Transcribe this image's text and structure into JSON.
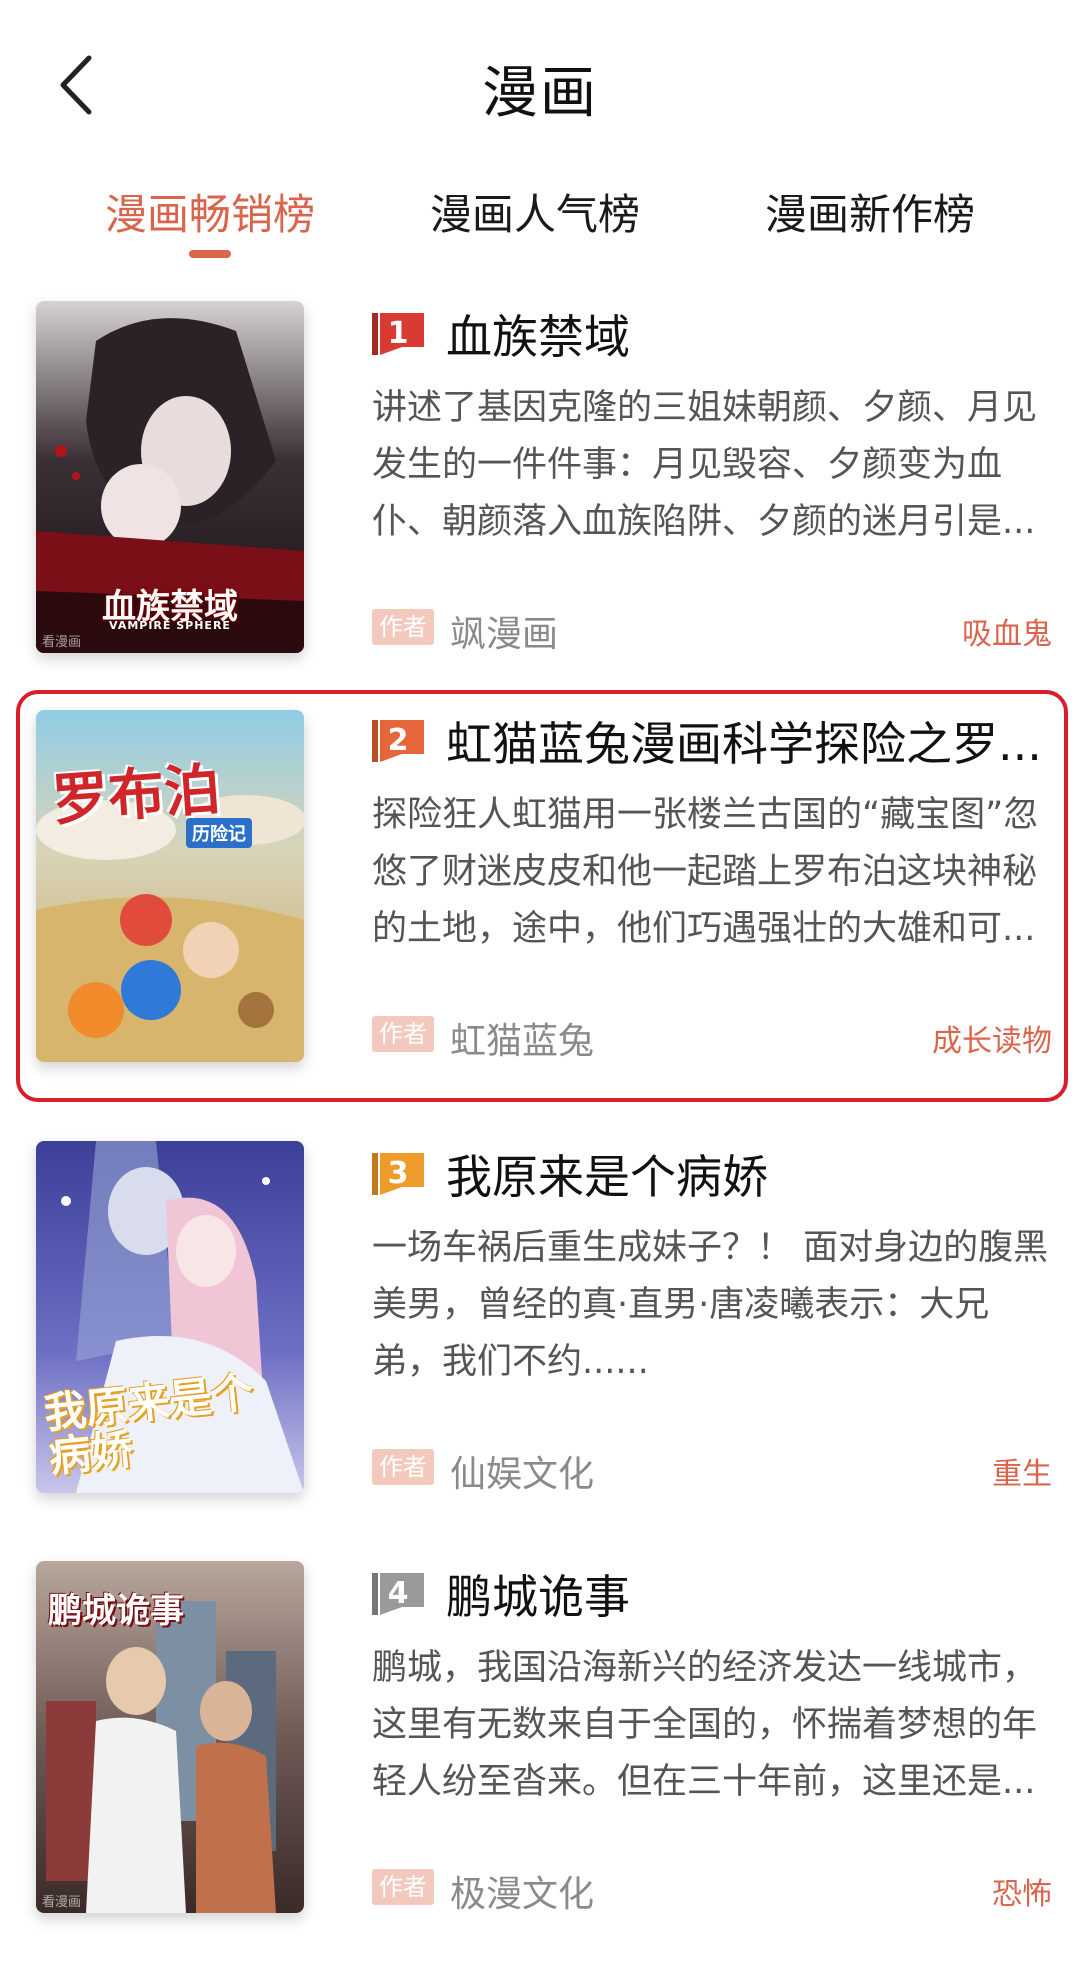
{
  "header": {
    "title": "漫画"
  },
  "tabs": [
    {
      "label": "漫画畅销榜",
      "active": true
    },
    {
      "label": "漫画人气榜",
      "active": false
    },
    {
      "label": "漫画新作榜",
      "active": false
    }
  ],
  "author_tag": "作者",
  "items": [
    {
      "rank": "1",
      "badge_color": "#d93b33",
      "title": "血族禁域",
      "description": "讲述了基因克隆的三姐妹朝颜、夕颜、月见发生的一件件事：月见毁容、夕颜变为血仆、朝颜落入血族陷阱、夕颜的迷月引是...",
      "author": "飒漫画",
      "genre": "吸血鬼",
      "cover_text": "血族禁域",
      "cover_subtext": "VAMPIRE SPHERE",
      "cover_watermark": "看漫画"
    },
    {
      "rank": "2",
      "badge_color": "#e5663a",
      "title": "虹猫蓝兔漫画科学探险之罗...",
      "description": "探险狂人虹猫用一张楼兰古国的“藏宝图”忽悠了财迷皮皮和他一起踏上罗布泊这块神秘的土地，途中，他们巧遇强壮的大雄和可...",
      "author": "虹猫蓝兔",
      "genre": "成长读物",
      "cover_text": "罗布泊",
      "cover_subtext": "历险记"
    },
    {
      "rank": "3",
      "badge_color": "#ee9b2c",
      "title": "我原来是个病娇",
      "description": "一场车祸后重生成妹子？！ 面对身边的腹黑美男，曾经的真·直男·唐凌曦表示：大兄弟，我们不约......",
      "author": "仙娱文化",
      "genre": "重生",
      "cover_text": "我原来是个病娇"
    },
    {
      "rank": "4",
      "badge_color": "#9a9a9a",
      "title": "鹏城诡事",
      "description": "鹏城，我国沿海新兴的经济发达一线城市，这里有无数来自于全国的，怀揣着梦想的年轻人纷至沓来。但在三十年前，这里还是...",
      "author": "极漫文化",
      "genre": "恐怖",
      "cover_text": "鹏城诡事",
      "cover_watermark": "看漫画"
    }
  ]
}
